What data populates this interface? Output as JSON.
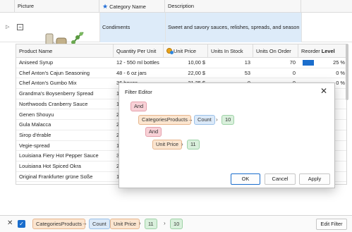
{
  "master": {
    "columns": [
      "Picture",
      "Category Name",
      "Description"
    ],
    "row": {
      "category": "Condiments",
      "description": "Sweet and savory sauces, relishes, spreads, and seasoni..."
    }
  },
  "detail": {
    "columns": [
      "Product Name",
      "Quantity Per Unit",
      "Unit Price",
      "Units In Stock",
      "Units On Order",
      "Reorder",
      "Level"
    ],
    "rows": [
      {
        "name": "Aniseed Syrup",
        "qty": "12 - 550 ml bottles",
        "price": "10,00 $",
        "stock": "13",
        "order": "70",
        "level": 0.25,
        "level_text": "25 %"
      },
      {
        "name": "Chef Anton's Cajun Seasoning",
        "qty": "48 - 6 oz jars",
        "price": "22,00 $",
        "stock": "53",
        "order": "0",
        "level": 0,
        "level_text": "0 %"
      },
      {
        "name": "Chef Anton's Gumbo Mix",
        "qty": "36 boxes",
        "price": "21,35 $",
        "stock": "0",
        "order": "0",
        "level": 0,
        "level_text": "0 %"
      },
      {
        "name": "Grandma's Boysenberry Spread",
        "qty": "1",
        "price": "",
        "stock": "",
        "order": "",
        "level": 0,
        "level_text": ""
      },
      {
        "name": "Northwoods Cranberry Sauce",
        "qty": "1",
        "price": "",
        "stock": "",
        "order": "",
        "level": 0,
        "level_text": ""
      },
      {
        "name": "Genen Shouyu",
        "qty": "2",
        "price": "",
        "stock": "",
        "order": "",
        "level": 0,
        "level_text": ""
      },
      {
        "name": "Gula Malacca",
        "qty": "2",
        "price": "",
        "stock": "",
        "order": "",
        "level": 0,
        "level_text": ""
      },
      {
        "name": "Sirop d'érable",
        "qty": "2",
        "price": "",
        "stock": "",
        "order": "",
        "level": 0,
        "level_text": ""
      },
      {
        "name": "Vegie-spread",
        "qty": "1",
        "price": "",
        "stock": "",
        "order": "",
        "level": 0,
        "level_text": ""
      },
      {
        "name": "Louisiana Fiery Hot Pepper Sauce",
        "qty": "3",
        "price": "",
        "stock": "",
        "order": "",
        "level": 0,
        "level_text": ""
      },
      {
        "name": "Louisiana Hot Spiced Okra",
        "qty": "2",
        "price": "",
        "stock": "",
        "order": "",
        "level": 0,
        "level_text": ""
      },
      {
        "name": "Original Frankfurter grüne Soße",
        "qty": "1",
        "price": "",
        "stock": "",
        "order": "",
        "level": 0,
        "level_text": ""
      }
    ]
  },
  "dialog": {
    "title": "Filter Editor",
    "group_and": "And",
    "field_categories": "CategoriesProducts",
    "agg_count": "Count",
    "value_10": "10",
    "group_and_inner": "And",
    "field_unit_price": "Unit Price",
    "value_11": "11",
    "ok": "OK",
    "cancel": "Cancel",
    "apply": "Apply"
  },
  "filter_panel": {
    "field_categories": "CategoriesProducts",
    "agg_count": "Count",
    "field_unit_price": "Unit Price",
    "value_11": "11",
    "value_10": "10",
    "edit_filter": "Edit Filter"
  },
  "colors": {
    "accent": "#1a6dcc",
    "selection": "#ddebf9"
  }
}
